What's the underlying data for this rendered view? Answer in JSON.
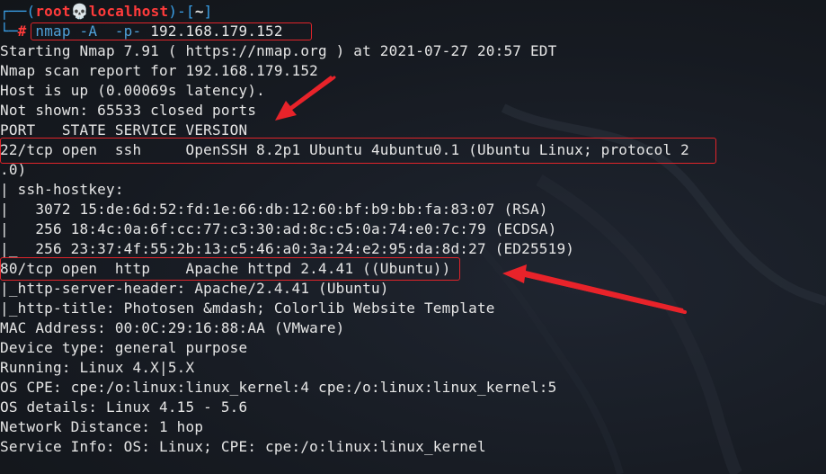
{
  "prompt": {
    "open": "┌──(",
    "user": "root",
    "skull": "💀",
    "host": "localhost",
    "close": ")-[",
    "dir": "~",
    "end": "]",
    "line2": "└─",
    "hash": "#",
    "cmd": "nmap -A  -p-",
    "ip": "192.168.179.152"
  },
  "output": [
    "Starting Nmap 7.91 ( https://nmap.org ) at 2021-07-27 20:57 EDT",
    "Nmap scan report for 192.168.179.152",
    "Host is up (0.00069s latency).",
    "Not shown: 65533 closed ports",
    "PORT   STATE SERVICE VERSION",
    "22/tcp open  ssh     OpenSSH 8.2p1 Ubuntu 4ubuntu0.1 (Ubuntu Linux; protocol 2",
    ".0)",
    "| ssh-hostkey:",
    "|   3072 15:de:6d:52:fd:1e:66:db:12:60:bf:b9:bb:fa:83:07 (RSA)",
    "|   256 18:4c:0a:6f:cc:77:c3:30:ad:8c:c5:0a:74:e0:7c:79 (ECDSA)",
    "|_  256 23:37:4f:55:2b:13:c5:46:a0:3a:24:e2:95:da:8d:27 (ED25519)",
    "80/tcp open  http    Apache httpd 2.4.41 ((Ubuntu))",
    "|_http-server-header: Apache/2.4.41 (Ubuntu)",
    "|_http-title: Photosen &mdash; Colorlib Website Template",
    "MAC Address: 00:0C:29:16:88:AA (VMware)",
    "Device type: general purpose",
    "Running: Linux 4.X|5.X",
    "OS CPE: cpe:/o:linux:linux_kernel:4 cpe:/o:linux:linux_kernel:5",
    "OS details: Linux 4.15 - 5.6",
    "Network Distance: 1 hop",
    "Service Info: OS: Linux; CPE: cpe:/o:linux:linux_kernel"
  ],
  "colors": {
    "background": "#161a21",
    "text": "#e6e6e6",
    "prompt_frame": "#3aa0e8",
    "prompt_user": "#ff3b3b",
    "command": "#4fa0d8",
    "annotation": "#e0242a"
  }
}
